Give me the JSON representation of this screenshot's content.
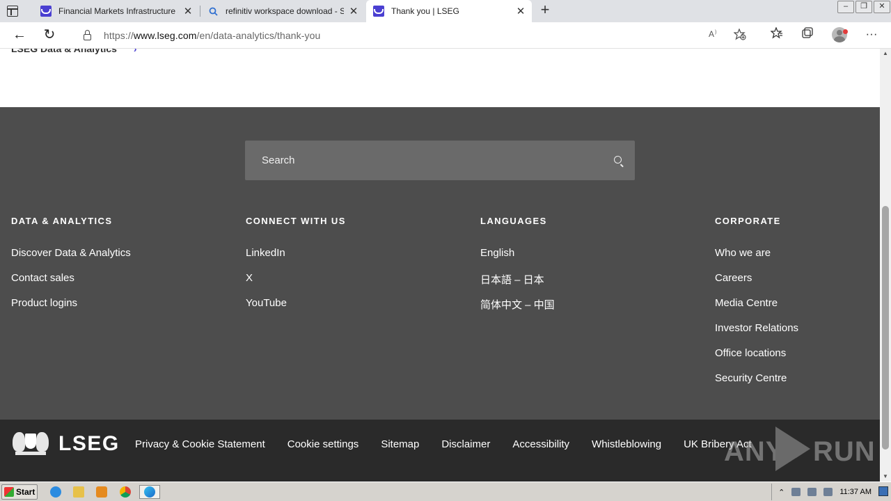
{
  "browser": {
    "tabs": [
      {
        "title": "Financial Markets Infrastructure a",
        "favicon": "lseg-icon",
        "active": false
      },
      {
        "title": "refinitiv workspace download - Se",
        "favicon": "search-icon",
        "active": false
      },
      {
        "title": "Thank you | LSEG",
        "favicon": "lseg-icon",
        "active": true
      }
    ],
    "tab_close": "✕",
    "new_tab": "+",
    "url_prefix": "https://",
    "url_domain": "www.lseg.com",
    "url_path": "/en/data-analytics/thank-you",
    "back": "←",
    "reload": "↻"
  },
  "page": {
    "breadcrumb": "LSEG Data & Analytics",
    "breadcrumb_chevron": "›",
    "search": {
      "placeholder": "Search"
    },
    "columns": [
      {
        "heading": "DATA & ANALYTICS",
        "links": [
          "Discover Data & Analytics",
          "Contact sales",
          "Product logins"
        ]
      },
      {
        "heading": "CONNECT WITH US",
        "links": [
          "LinkedIn",
          "X",
          "YouTube"
        ]
      },
      {
        "heading": "LANGUAGES",
        "links": [
          "English",
          "日本語 – 日本",
          "简体中文 – 中国"
        ]
      },
      {
        "heading": "CORPORATE",
        "links": [
          "Who we are",
          "Careers",
          "Media Centre",
          "Investor Relations",
          "Office locations",
          "Security Centre"
        ]
      }
    ],
    "logo_text": "LSEG",
    "legal_links": [
      "Privacy & Cookie Statement",
      "Cookie settings",
      "Sitemap",
      "Disclaimer",
      "Accessibility",
      "Whistleblowing",
      "UK Bribery Act"
    ],
    "watermark": {
      "left": "ANY",
      "right": "RUN"
    }
  },
  "taskbar": {
    "start_label": "Start",
    "clock": "11:37 AM",
    "apps": [
      "ie-icon",
      "folder-icon",
      "media-icon",
      "chrome-icon",
      "edge-icon"
    ]
  },
  "colors": {
    "footer_top": "#4d4d4d",
    "footer_bottom": "#2a2a2a",
    "accent": "#4a3fd1"
  }
}
